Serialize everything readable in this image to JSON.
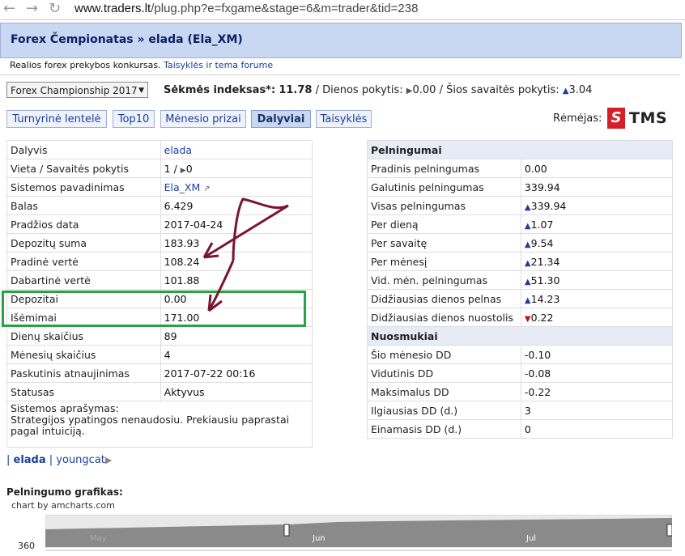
{
  "browser": {
    "url_host": "www.traders.lt",
    "url_path": "/plug.php?e=fxgame&stage=6&m=trader&tid=238"
  },
  "header": {
    "title": "Forex Čempionatas » elada (Ela_XM)"
  },
  "subline": {
    "text": "Realios forex prekybos konkursas. ",
    "link": "Taisyklės ir tema forume"
  },
  "toolbar": {
    "championship_select": "Forex Championship 2017",
    "index_label": "Sėkmės indeksas*:",
    "index_value": "11.78",
    "day_change_label": " / Dienos pokytis: ",
    "day_change_value": "0.00",
    "week_change_label": " / Šios savaitės pokytis: ",
    "week_change_value": "3.04"
  },
  "tabs": [
    {
      "label": "Turnyrinė lentelė"
    },
    {
      "label": "Top10"
    },
    {
      "label": "Mėnesio prizai"
    },
    {
      "label": "Dalyviai"
    },
    {
      "label": "Taisyklės"
    }
  ],
  "sponsor": {
    "label": "Rėmėjas:",
    "logo_text": "TMS"
  },
  "left_table": {
    "rows": [
      {
        "label": "Dalyvis",
        "value": "elada"
      },
      {
        "label": "Vieta / Savaitės pokytis",
        "value": "1 / ",
        "extra": "0"
      },
      {
        "label": "Sistemos pavadinimas",
        "value": "Ela_XM"
      },
      {
        "label": "Balas",
        "value": "6.429"
      },
      {
        "label": "Pradžios data",
        "value": "2017-04-24"
      },
      {
        "label": "Depozitų suma",
        "value": "183.93"
      },
      {
        "label": "Pradinė vertė",
        "value": "108.24"
      },
      {
        "label": "Dabartinė vertė",
        "value": "101.88"
      },
      {
        "label": "Depozitai",
        "value": "0.00"
      },
      {
        "label": "Išėmimai",
        "value": "171.00"
      },
      {
        "label": "Dienų skaičius",
        "value": "89"
      },
      {
        "label": "Mėnesių skaičius",
        "value": "4"
      },
      {
        "label": "Paskutinis atnaujinimas",
        "value": "2017-07-22 00:16"
      },
      {
        "label": "Statusas",
        "value": "Aktyvus"
      }
    ],
    "description_label": "Sistemos aprašymas:",
    "description_line1": "Strategijos ypatingos nenaudosiu. Prekiausiu paprastai",
    "description_line2": "pagal intuiciją."
  },
  "right_table": {
    "section1": "Pelningumai",
    "rows1": [
      {
        "label": "Pradinis pelningumas",
        "value": "0.00",
        "dir": ""
      },
      {
        "label": "Galutinis pelningumas",
        "value": "339.94",
        "dir": ""
      },
      {
        "label": "Visas pelningumas",
        "value": "339.94",
        "dir": "up"
      },
      {
        "label": "Per dieną",
        "value": "1.07",
        "dir": "up"
      },
      {
        "label": "Per savaitę",
        "value": "9.54",
        "dir": "up"
      },
      {
        "label": "Per mėnesį",
        "value": "21.34",
        "dir": "up"
      },
      {
        "label": "Vid. mėn. pelningumas",
        "value": "51.30",
        "dir": "up"
      },
      {
        "label": "Didžiausias dienos pelnas",
        "value": "14.23",
        "dir": "up"
      },
      {
        "label": "Didžiausias dienos nuostolis",
        "value": "0.22",
        "dir": "down"
      }
    ],
    "section2": "Nuosmukiai",
    "rows2": [
      {
        "label": "Šio mėnesio DD",
        "value": "-0.10"
      },
      {
        "label": "Vidutinis DD",
        "value": "-0.08"
      },
      {
        "label": "Maksimalus DD",
        "value": "-0.22"
      },
      {
        "label": "Ilgiausias DD (d.)",
        "value": "3"
      },
      {
        "label": "Einamasis DD (d.)",
        "value": "0"
      }
    ]
  },
  "users_nav": {
    "current": "elada",
    "next": "youngcat"
  },
  "chart": {
    "title": "Pelningumo grafikas:",
    "credit": "chart by amcharts.com",
    "y_tick": "360",
    "months": [
      "May",
      "Jun",
      "Jul"
    ]
  },
  "colors": {
    "header_bg": "#c8d7f2",
    "link": "#1a3fa4",
    "highlight_box": "#27a346",
    "annotation_arrow": "#7a1530",
    "tms_red": "#d42027"
  }
}
